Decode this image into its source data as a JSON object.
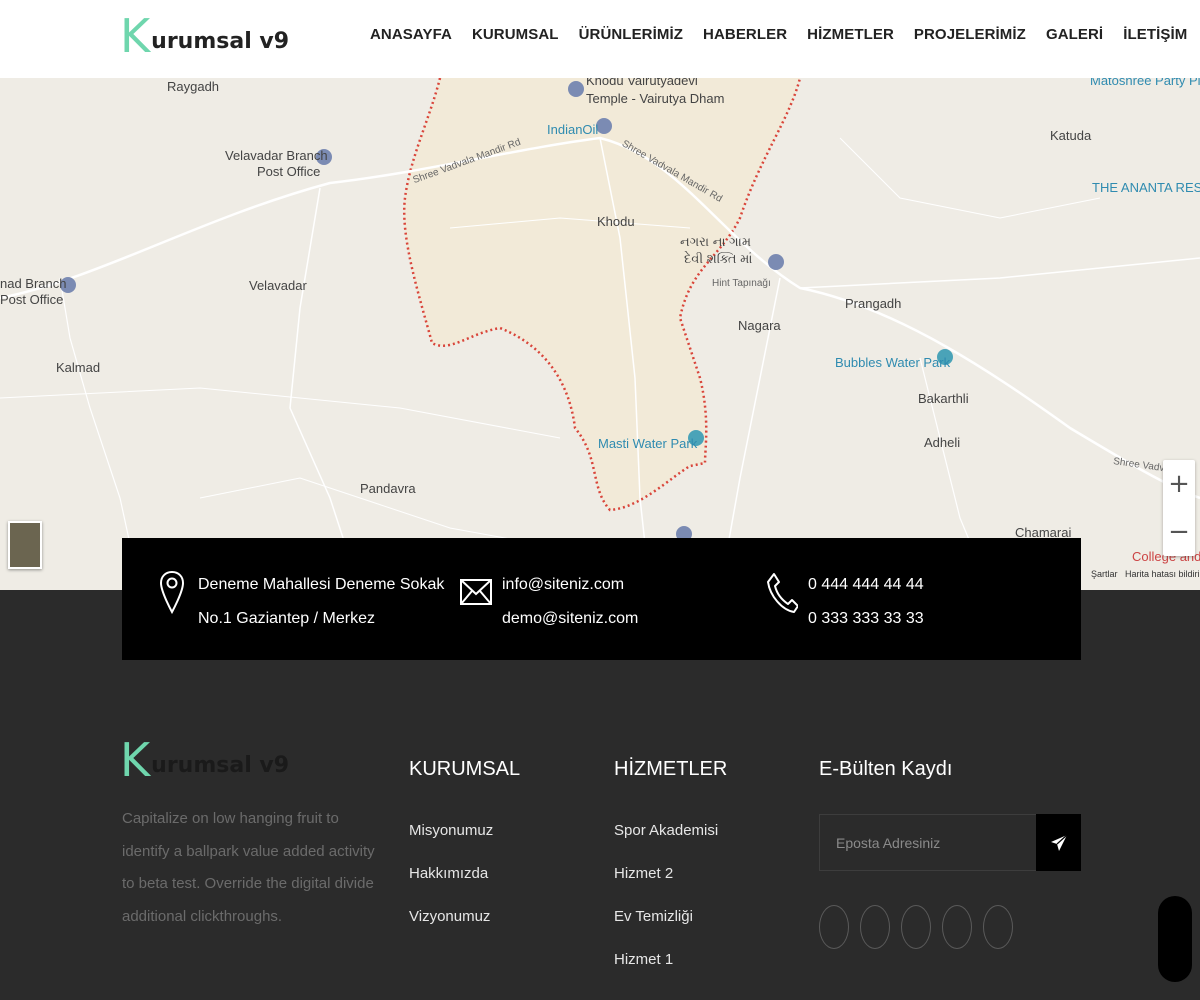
{
  "header": {
    "logo_letter": "K",
    "logo_text": "urumsal v9",
    "nav": [
      "ANASAYFA",
      "KURUMSAL",
      "ÜRÜNLERİMİZ",
      "HABERLER",
      "HİZMETLER",
      "PROJELERİMİZ",
      "GALERİ",
      "İLETİŞİM"
    ]
  },
  "map": {
    "labels": {
      "raygadh": "Raygadh",
      "khodu_temple_1": "Khodu Vairutyadevi",
      "khodu_temple_2": "Temple - Vairutya Dham",
      "indianoil": "IndianOil",
      "road1": "Shree Vadvala Mandir Rd",
      "road2": "Shree Vadvala Mandir Rd",
      "matoshree": "Matoshree Party Plot",
      "katuda": "Katuda",
      "ananta": "THE ANANTA RESOR",
      "velavadar_branch_1": "Velavadar Branch",
      "velavadar_branch_2": "Post Office",
      "khodu": "Khodu",
      "nagra_1": "નગરા ના ગામ",
      "nagra_2": "દેવી શક્તિ માં",
      "hint_tapinagi": "Hint Tapınağı",
      "branch_left_1": "nad Branch",
      "branch_left_2": "Post Office",
      "velavadar": "Velavadar",
      "prangadh": "Prangadh",
      "nagara": "Nagara",
      "kalmad": "Kalmad",
      "bubbles": "Bubbles Water Park",
      "bakarthli": "Bakarthli",
      "adheli": "Adheli",
      "masti": "Masti Water Park",
      "road3": "Shree Vadva",
      "pandavra": "Pandavra",
      "chamarai": "Chamarai",
      "college_1": "C",
      "college_2": "College and H"
    },
    "zoom_in": "+",
    "zoom_out": "−",
    "terms": "Şartlar",
    "report": "Harita hatası bildirin"
  },
  "contact": {
    "address_1": "Deneme Mahallesi Deneme Sokak",
    "address_2": "No.1 Gaziantep / Merkez",
    "email_1": "info@siteniz.com",
    "email_2": "demo@siteniz.com",
    "phone_1": "0 444 444 44 44",
    "phone_2": "0 333 333 33 33"
  },
  "footer": {
    "logo_letter": "K",
    "logo_text": "urumsal v9",
    "description": "Capitalize on low hanging fruit to identify a ballpark value added activity to beta test. Override the digital divide additional clickthroughs.",
    "col1_title": "KURUMSAL",
    "col1_links": [
      "Misyonumuz",
      "Hakkımızda",
      "Vizyonumuz"
    ],
    "col2_title": "HİZMETLER",
    "col2_links": [
      "Spor Akademisi",
      "Hizmet 2",
      "Ev Temizliği",
      "Hizmet 1"
    ],
    "newsletter_title": "E-Bülten Kaydı",
    "newsletter_placeholder": "Eposta Adresiniz"
  },
  "colors": {
    "accent": "#6fd6ad",
    "footer_bg": "#2b2b2b",
    "contact_bg": "#000000",
    "map_bg": "#efece5",
    "boundary": "#d9453a"
  }
}
